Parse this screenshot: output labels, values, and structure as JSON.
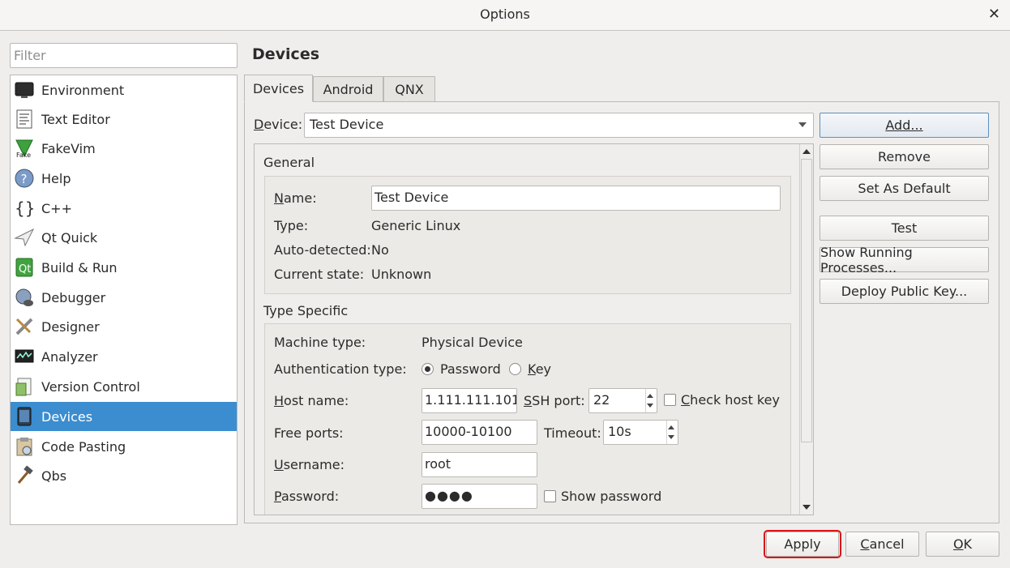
{
  "window": {
    "title": "Options",
    "close_glyph": "✕"
  },
  "filter": {
    "placeholder": "Filter",
    "value": ""
  },
  "nav": {
    "items": [
      {
        "label": "Environment",
        "icon": "monitor-icon"
      },
      {
        "label": "Text Editor",
        "icon": "document-icon"
      },
      {
        "label": "FakeVim",
        "icon": "fakevim-icon"
      },
      {
        "label": "Help",
        "icon": "help-icon"
      },
      {
        "label": "C++",
        "icon": "braces-icon"
      },
      {
        "label": "Qt Quick",
        "icon": "paper-plane-icon"
      },
      {
        "label": "Build & Run",
        "icon": "qt-build-icon"
      },
      {
        "label": "Debugger",
        "icon": "debugger-icon"
      },
      {
        "label": "Designer",
        "icon": "designer-icon"
      },
      {
        "label": "Analyzer",
        "icon": "analyzer-icon"
      },
      {
        "label": "Version Control",
        "icon": "version-control-icon"
      },
      {
        "label": "Devices",
        "icon": "tablet-icon"
      },
      {
        "label": "Code Pasting",
        "icon": "code-pasting-icon"
      },
      {
        "label": "Qbs",
        "icon": "hammer-icon"
      }
    ],
    "selected": "Devices"
  },
  "page": {
    "heading": "Devices"
  },
  "tabs": [
    {
      "label": "Devices"
    },
    {
      "label": "Android"
    },
    {
      "label": "QNX"
    }
  ],
  "device": {
    "label_pre": "D",
    "label_rest": "evice:",
    "value": "Test Device"
  },
  "buttons": {
    "add": "Add...",
    "remove": "Remove",
    "set_default": "Set As Default",
    "test": "Test",
    "show_processes": "Show Running Processes...",
    "deploy_key": "Deploy Public Key..."
  },
  "general": {
    "title": "General",
    "name_label_pre": "N",
    "name_label_rest": "ame:",
    "name_value": "Test Device",
    "type_label": "Type:",
    "type_value": "Generic Linux",
    "auto_label": "Auto-detected:",
    "auto_value": "No",
    "state_label": "Current state:",
    "state_value": "Unknown"
  },
  "specific": {
    "title": "Type Specific",
    "machine_label": "Machine type:",
    "machine_value": "Physical Device",
    "auth_label": "Authentication type:",
    "auth_password": "Password",
    "auth_key_pre": "K",
    "auth_key_rest": "ey",
    "host_label_pre": "H",
    "host_label_rest": "ost name:",
    "host_value": "1.111.111.101",
    "ssh_label_pre": "S",
    "ssh_label_rest": "SH port:",
    "ssh_value": "22",
    "check_host_pre": "C",
    "check_host_rest": "heck host key",
    "ports_label": "Free ports:",
    "ports_value": "10000-10100",
    "timeout_label": "Timeout:",
    "timeout_value": "10s",
    "user_label_pre": "U",
    "user_label_rest": "sername:",
    "user_value": "root",
    "pass_label_pre": "P",
    "pass_label_rest": "assword:",
    "pass_value": "●●●●",
    "show_password": "Show password"
  },
  "footer": {
    "apply": "Apply",
    "cancel_pre": "C",
    "cancel_rest": "ancel",
    "ok_pre": "O",
    "ok_rest": "K"
  }
}
